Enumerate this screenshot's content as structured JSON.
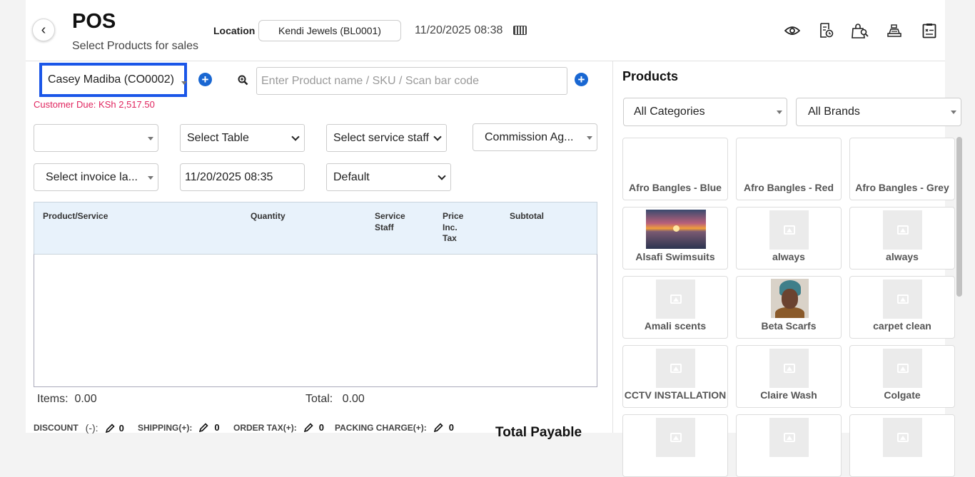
{
  "header": {
    "title": "POS",
    "subtitle": "Select Products for sales",
    "location_label": "Location",
    "location_value": "Kendi Jewels (BL0001)",
    "datetime": "11/20/2025 08:38"
  },
  "icons": {
    "back": "chevron-left-icon",
    "keyboard": "keyboard-icon",
    "view": "eye-icon",
    "recent": "invoice-clock-icon",
    "suspended": "bag-search-icon",
    "register": "cash-register-icon",
    "close": "clipboard-close-icon",
    "search": "zoom-in-icon",
    "add": "plus-circle-icon",
    "edit": "pencil-icon"
  },
  "customer": {
    "selected": "Casey Madiba (CO0002)",
    "due_label": "Customer Due:",
    "due_value": "KSh 2,517.50"
  },
  "search": {
    "placeholder": "Enter Product name / SKU / Scan bar code"
  },
  "selects": {
    "blank": "",
    "table": "Select Table",
    "service_staff": "Select service staff",
    "commission": "Commission Ag...",
    "invoice_layout": "Select invoice la...",
    "date": "11/20/2025 08:35",
    "price_group": "Default"
  },
  "table": {
    "headers": [
      "Product/Service",
      "Quantity",
      "Service Staff",
      "Price Inc. Tax",
      "Subtotal"
    ]
  },
  "totals": {
    "items_label": "Items:",
    "items_value": "0.00",
    "total_label": "Total:",
    "total_value": "0.00"
  },
  "footer": {
    "discount_label": "DISCOUNT",
    "discount_sign": "(-):",
    "discount_value": "0",
    "shipping_label": "SHIPPING(+):",
    "shipping_value": "0",
    "tax_label": "ORDER TAX(+):",
    "tax_value": "0",
    "packing_label": "PACKING CHARGE(+):",
    "packing_value": "0",
    "total_payable": "Total Payable"
  },
  "products": {
    "title": "Products",
    "category_filter": "All Categories",
    "brand_filter": "All Brands",
    "items": [
      {
        "name": "Afro Bangles - Blue",
        "img": "none"
      },
      {
        "name": "Afro Bangles - Red",
        "img": "none"
      },
      {
        "name": "Afro Bangles - Grey",
        "img": "none"
      },
      {
        "name": "Alsafi Swimsuits",
        "img": "sunset"
      },
      {
        "name": "always",
        "img": "placeholder"
      },
      {
        "name": "always",
        "img": "placeholder"
      },
      {
        "name": "Amali scents",
        "img": "placeholder"
      },
      {
        "name": "Beta Scarfs",
        "img": "portrait"
      },
      {
        "name": "carpet clean",
        "img": "placeholder"
      },
      {
        "name": "CCTV INSTALLATION",
        "img": "placeholder"
      },
      {
        "name": "Claire Wash",
        "img": "placeholder"
      },
      {
        "name": "Colgate",
        "img": "placeholder"
      },
      {
        "name": "",
        "img": "placeholder"
      },
      {
        "name": "",
        "img": "placeholder"
      },
      {
        "name": "",
        "img": "placeholder"
      }
    ]
  },
  "colors": {
    "accent": "#1967d2",
    "highlight": "#1a56e8",
    "due": "#e0245e",
    "table_header": "#e8f2fb"
  }
}
